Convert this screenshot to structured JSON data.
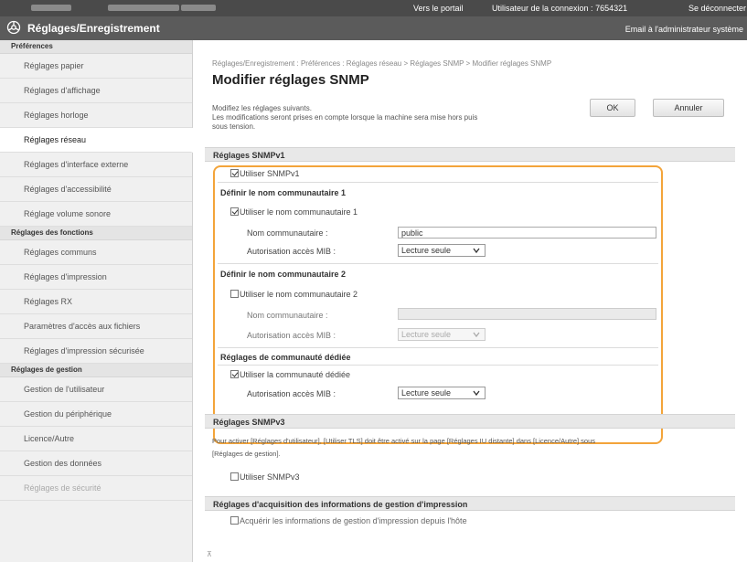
{
  "topbar": {
    "portal_link": "Vers le portail",
    "login_user_label": "Utilisateur de la connexion : 7654321",
    "logout_link": "Se déconnecter"
  },
  "titlebar": {
    "title": "Réglages/Enregistrement",
    "email_admin": "Email à l'administrateur système"
  },
  "sidebar": {
    "sections": [
      {
        "title": "Préférences",
        "items": [
          "Réglages papier",
          "Réglages d'affichage",
          "Réglages horloge",
          "Réglages réseau",
          "Réglages d'interface externe",
          "Réglages d'accessibilité",
          "Réglage volume sonore"
        ]
      },
      {
        "title": "Réglages des fonctions",
        "items": [
          "Réglages communs",
          "Réglages d'impression",
          "Réglages RX",
          "Paramètres d'accès aux fichiers",
          "Réglages d'impression sécurisée"
        ]
      },
      {
        "title": "Réglages de gestion",
        "items": [
          "Gestion de l'utilisateur",
          "Gestion du périphérique",
          "Licence/Autre",
          "Gestion des données",
          "Réglages de sécurité"
        ]
      }
    ],
    "active_item": "Réglages réseau"
  },
  "main": {
    "breadcrumb": "Réglages/Enregistrement : Préférences : Réglages réseau > Réglages SNMP > Modifier réglages SNMP",
    "title": "Modifier réglages SNMP",
    "desc_line1": "Modifiez les réglages suivants.",
    "desc_line2": "Les modifications seront prises en compte lorsque la machine sera mise hors puis",
    "desc_line3": "sous tension.",
    "ok_label": "OK",
    "cancel_label": "Annuler",
    "snmpv1": {
      "header": "Réglages SNMPv1",
      "use_snmpv1": "Utiliser SNMPv1",
      "community1_header": "Définir le nom communautaire 1",
      "use_community1": "Utiliser le nom communautaire 1",
      "community_name_label": "Nom communautaire :",
      "community1_value": "public",
      "mib_access_label": "Autorisation accès MIB :",
      "community1_mib": "Lecture seule",
      "community2_header": "Définir le nom communautaire 2",
      "use_community2": "Utiliser le nom communautaire 2",
      "community2_value": "",
      "community2_mib": "Lecture seule",
      "dedicated_header": "Réglages de communauté dédiée",
      "use_dedicated": "Utiliser la communauté dédiée",
      "dedicated_mib": "Lecture seule"
    },
    "snmpv3": {
      "header": "Réglages SNMPv3",
      "note_line1": "Pour activer [Réglages d'utilisateur], [Utiliser TLS] doit être activé sur la page [Réglages IU distante] dans [Licence/Autre] sous",
      "note_line2": "[Réglages de gestion].",
      "use_snmpv3": "Utiliser SNMPv3"
    },
    "print_mgmt": {
      "header": "Réglages d'acquisition des informations de gestion d'impression",
      "acquire_label": "Acquérir les informations de gestion d'impression depuis l'hôte"
    }
  },
  "colors": {
    "highlight": "#f3a43a",
    "topbar": "#4a4a4a",
    "titlebar": "#5b5b5b"
  }
}
